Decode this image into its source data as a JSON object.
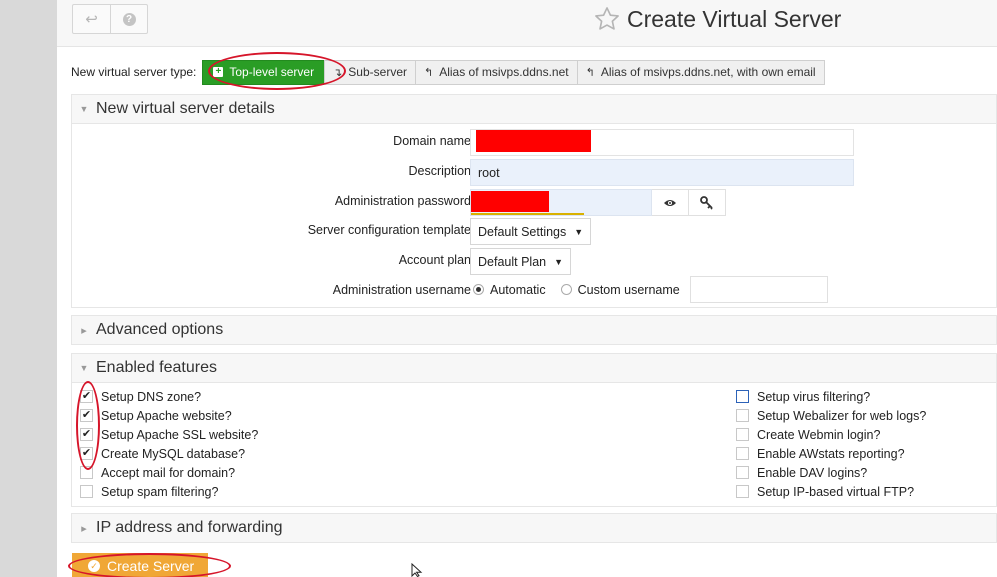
{
  "header": {
    "title": "Create Virtual Server",
    "back_icon": "↩",
    "help_icon": "?"
  },
  "server_type": {
    "label": "New virtual server type:",
    "options": [
      {
        "label": "Top-level server",
        "icon": "plus-square-icon",
        "selected": true
      },
      {
        "label": "Sub-server",
        "icon": "sub-arrow-icon",
        "selected": false
      },
      {
        "label": "Alias of msivps.ddns.net",
        "icon": "reply-arrow-icon",
        "selected": false
      },
      {
        "label": "Alias of msivps.ddns.net, with own email",
        "icon": "reply-all-icon",
        "selected": false
      }
    ]
  },
  "details": {
    "title": "New virtual server details",
    "domain_label": "Domain name",
    "domain_value": "",
    "description_label": "Description",
    "description_value": "root",
    "password_label": "Administration password",
    "template_label": "Server configuration template",
    "template_value": "Default Settings",
    "plan_label": "Account plan",
    "plan_value": "Default Plan",
    "username_label": "Administration username",
    "username_automatic": "Automatic",
    "username_custom": "Custom username",
    "username_mode": "automatic"
  },
  "advanced": {
    "title": "Advanced options"
  },
  "features": {
    "title": "Enabled features",
    "left": [
      {
        "label": "Setup DNS zone?",
        "checked": true
      },
      {
        "label": "Setup Apache website?",
        "checked": true
      },
      {
        "label": "Setup Apache SSL website?",
        "checked": true
      },
      {
        "label": "Create MySQL database?",
        "checked": true
      },
      {
        "label": "Accept mail for domain?",
        "checked": false
      },
      {
        "label": "Setup spam filtering?",
        "checked": false
      }
    ],
    "right": [
      {
        "label": "Setup virus filtering?",
        "checked": false
      },
      {
        "label": "Setup Webalizer for web logs?",
        "checked": false
      },
      {
        "label": "Create Webmin login?",
        "checked": false
      },
      {
        "label": "Enable AWstats reporting?",
        "checked": false
      },
      {
        "label": "Enable DAV logins?",
        "checked": false
      },
      {
        "label": "Setup IP-based virtual FTP?",
        "checked": false
      }
    ]
  },
  "ip": {
    "title": "IP address and forwarding"
  },
  "actions": {
    "create_label": "Create Server"
  },
  "colors": {
    "primary_green": "#2a9d25",
    "create_orange": "#f0a736",
    "annotation_red": "#d6152a",
    "redaction_red": "#ff0000"
  }
}
